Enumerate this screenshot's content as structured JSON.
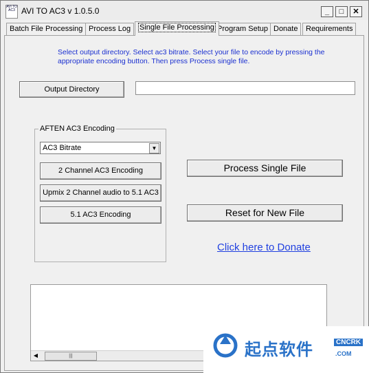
{
  "window": {
    "title": "AVI TO AC3 v 1.0.5.0",
    "icon_text": "AVI TO AC3",
    "controls": {
      "minimize": "_",
      "maximize": "□",
      "close": "✕"
    }
  },
  "tabs": [
    {
      "label": "Batch File Processing"
    },
    {
      "label": "Process Log"
    },
    {
      "label": "Single File Processing",
      "active": true
    },
    {
      "label": "Program Setup"
    },
    {
      "label": "Donate"
    },
    {
      "label": "Requirements"
    }
  ],
  "main": {
    "instructions": "Select output directory.  Select ac3 bitrate.  Select your file to encode by pressing the appropriate encoding button.  Then press Process single file.",
    "output_directory_button": "Output Directory",
    "output_directory_value": "",
    "group": {
      "label": "AFTEN AC3 Encoding",
      "bitrate_selected": "AC3 Bitrate",
      "buttons": [
        "2 Channel AC3 Encoding",
        "Upmix 2 Channel audio to 5.1 AC3",
        "5.1 AC3 Encoding"
      ]
    },
    "process_button": "Process Single File",
    "reset_button": "Reset for New File",
    "donate_link": "Click here to Donate",
    "log_text": ""
  },
  "watermark": {
    "text": "起点软件",
    "sub1": "CNCRK",
    "sub2": ".COM"
  },
  "colors": {
    "instructions": "#1a2fd0",
    "link": "#1f3fe0",
    "watermark": "#2a72c8"
  }
}
